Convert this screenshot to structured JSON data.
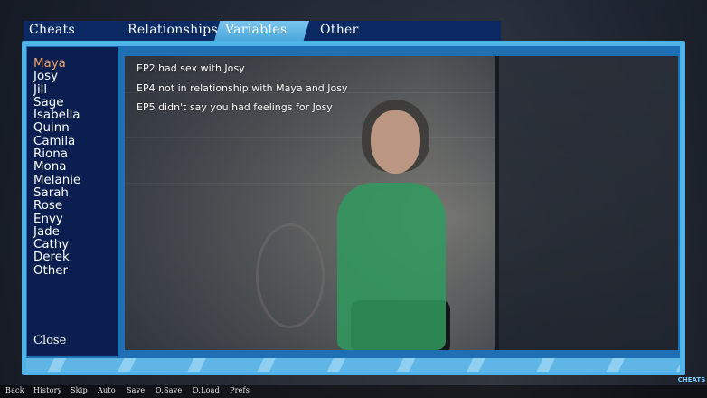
{
  "tabs": [
    {
      "label": "Cheats",
      "active": false
    },
    {
      "label": "Relationships",
      "active": false
    },
    {
      "label": "Variables",
      "active": true
    },
    {
      "label": "Other",
      "active": false
    }
  ],
  "characters": {
    "selected": "Maya",
    "items": [
      "Maya",
      "Josy",
      "Jill",
      "Sage",
      "Isabella",
      "Quinn",
      "Camila",
      "Riona",
      "Mona",
      "Melanie",
      "Sarah",
      "Rose",
      "Envy",
      "Jade",
      "Cathy",
      "Derek",
      "Other"
    ]
  },
  "variables": [
    "EP2 had sex with Josy",
    "EP4 not in relationship with Maya and Josy",
    "EP5 didn't say you had feelings for Josy"
  ],
  "close_label": "Close",
  "quick_menu": [
    "Back",
    "History",
    "Skip",
    "Auto",
    "Save",
    "Q.Save",
    "Q.Load",
    "Prefs"
  ],
  "badge_text": "CHEATS",
  "colors": {
    "accent": "#4fb3e8",
    "tab_bar": "#0b2a63",
    "active_tab": "#6ab9e8",
    "selected_character": "#f2a46a",
    "sidebar": "#0a1f4f"
  }
}
